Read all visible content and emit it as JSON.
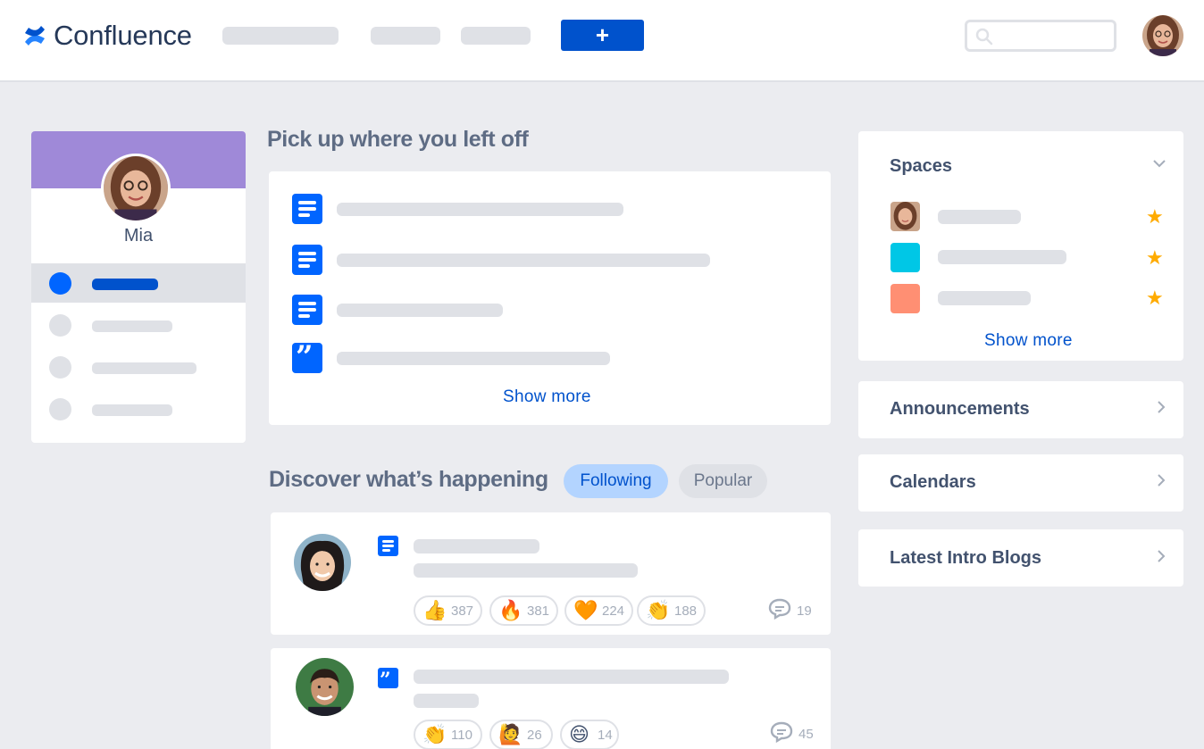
{
  "header": {
    "app_name": "Confluence",
    "create_label": "+",
    "search_placeholder": ""
  },
  "profile": {
    "name": "Mia"
  },
  "recent": {
    "title": "Pick up where you left off",
    "show_more": "Show more",
    "items": [
      {
        "icon": "page-icon"
      },
      {
        "icon": "page-icon"
      },
      {
        "icon": "page-icon"
      },
      {
        "icon": "quote-icon"
      }
    ]
  },
  "discover": {
    "title": "Discover what’s happening",
    "tabs": [
      {
        "label": "Following",
        "active": true
      },
      {
        "label": "Popular",
        "active": false
      }
    ],
    "feed": [
      {
        "type_icon": "page-icon",
        "reactions": [
          {
            "emoji": "👍",
            "count": "387"
          },
          {
            "emoji": "🔥",
            "count": "381"
          },
          {
            "emoji": "🧡",
            "count": "224"
          },
          {
            "emoji": "👏",
            "count": "188"
          }
        ],
        "comments": "19"
      },
      {
        "type_icon": "quote-icon",
        "reactions": [
          {
            "emoji": "👏",
            "count": "110"
          },
          {
            "emoji": "🙋",
            "count": "26"
          },
          {
            "emoji": "😄",
            "count": "14"
          }
        ],
        "comments": "45"
      }
    ]
  },
  "sidebar_right": {
    "spaces_title": "Spaces",
    "spaces_show_more": "Show more",
    "spaces": [
      {
        "kind": "avatar"
      },
      {
        "kind": "color",
        "color": "#00C7E6"
      },
      {
        "kind": "color",
        "color": "#FF8F73"
      }
    ],
    "panels": [
      {
        "label": "Announcements"
      },
      {
        "label": "Calendars"
      },
      {
        "label": "Latest Intro Blogs"
      }
    ]
  },
  "colors": {
    "brand": "#0052CC",
    "profile_banner": "#9F89D8",
    "star": "#FFAB00"
  }
}
